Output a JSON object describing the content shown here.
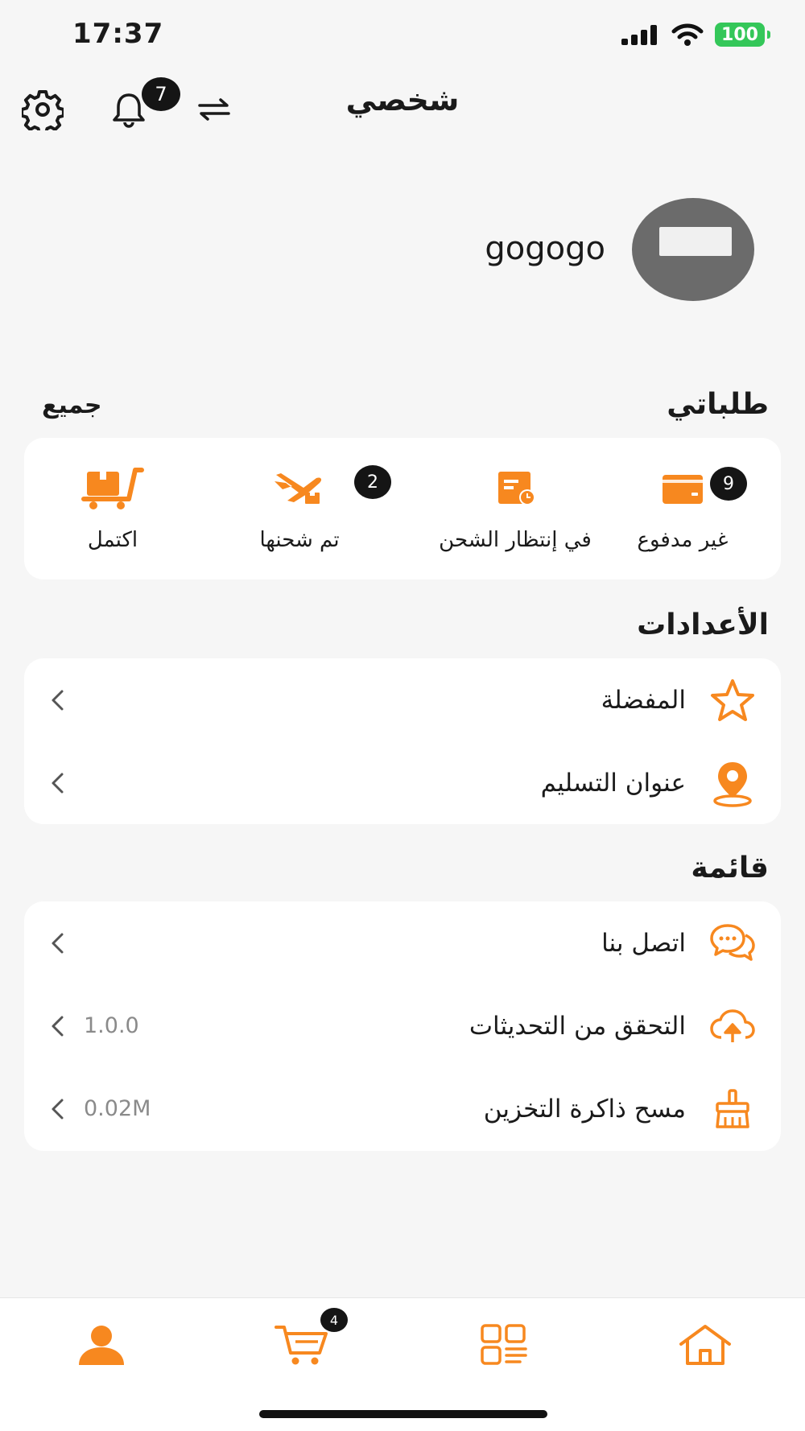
{
  "status_bar": {
    "time": "17:37",
    "battery": "100"
  },
  "header": {
    "title": "شخصي",
    "notification_count": "7"
  },
  "profile": {
    "username": "gogogo"
  },
  "orders": {
    "title": "طلباتي",
    "all_link": "جميع",
    "items": [
      {
        "label": "غير مدفوع",
        "icon": "wallet-icon",
        "badge": "9"
      },
      {
        "label": "في إنتظار الشحن",
        "icon": "pending-shipment-icon",
        "badge": ""
      },
      {
        "label": "تم شحنها",
        "icon": "airplane-icon",
        "badge": "2"
      },
      {
        "label": "اكتمل",
        "icon": "cart-box-icon",
        "badge": ""
      }
    ]
  },
  "settings": {
    "title": "الأعدادات",
    "items": [
      {
        "label": "المفضلة",
        "icon": "star-icon"
      },
      {
        "label": "عنوان التسليم",
        "icon": "location-pin-icon"
      }
    ]
  },
  "menu": {
    "title": "قائمة",
    "items": [
      {
        "label": "اتصل بنا",
        "icon": "chat-icon",
        "value": ""
      },
      {
        "label": "التحقق من التحديثات",
        "icon": "cloud-upload-icon",
        "value": "1.0.0"
      },
      {
        "label": "مسح ذاكرة التخزين",
        "icon": "broom-icon",
        "value": "0.02M"
      }
    ]
  },
  "bottom_nav": {
    "cart_badge": "4",
    "items": [
      "profile-icon",
      "cart-icon",
      "categories-icon",
      "home-icon"
    ]
  },
  "colors": {
    "accent": "#f7881f",
    "background": "#f6f6f6",
    "badge": "#151515"
  }
}
